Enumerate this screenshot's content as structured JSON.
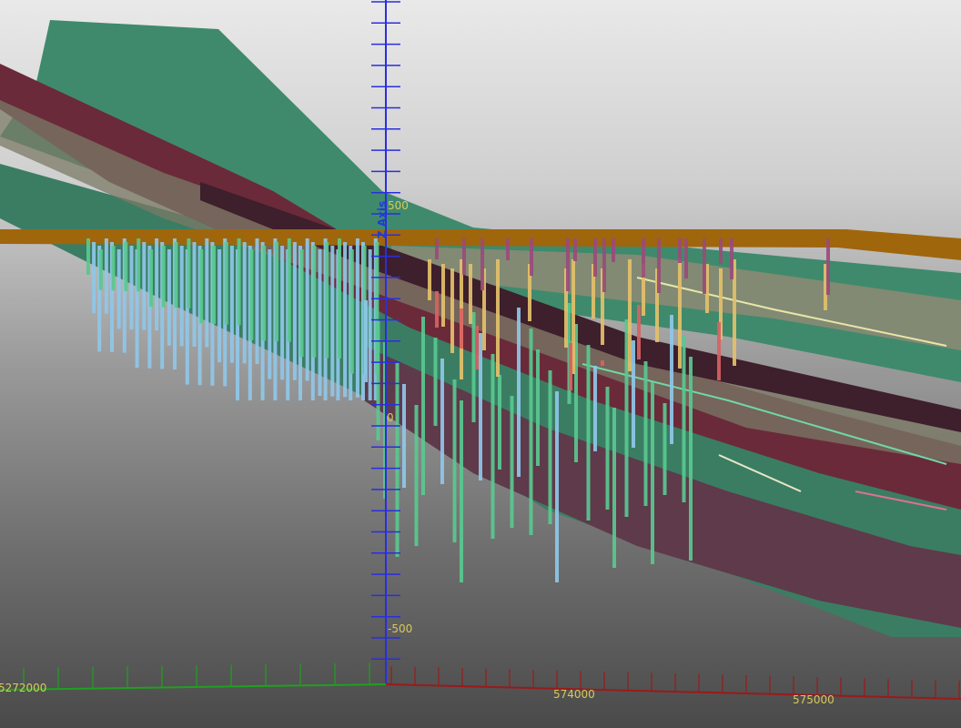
{
  "viewer": {
    "z_axis": {
      "title": "Z Axis",
      "ticks": [
        "500",
        "0",
        "-500"
      ]
    },
    "x_axis": {
      "ticks": [
        "574000",
        "575000"
      ]
    },
    "y_axis": {
      "ticks": [
        "5272000"
      ]
    }
  },
  "colors": {
    "z_axis": "#2a2ee0",
    "x_axis": "#9a1a1a",
    "y_axis": "#1fa01f",
    "axis_label": "#d8c95a",
    "topography": "#a0660c",
    "surface_green": "#3f8a6c",
    "surface_maroon": "#6a2a3a",
    "surface_olive": "#7b7a65",
    "drill_blue": "#8fc7e8",
    "drill_green": "#59c88f",
    "drill_yellow": "#e3c06a",
    "drill_purple": "#9a4b7a",
    "drill_red": "#d86262"
  }
}
